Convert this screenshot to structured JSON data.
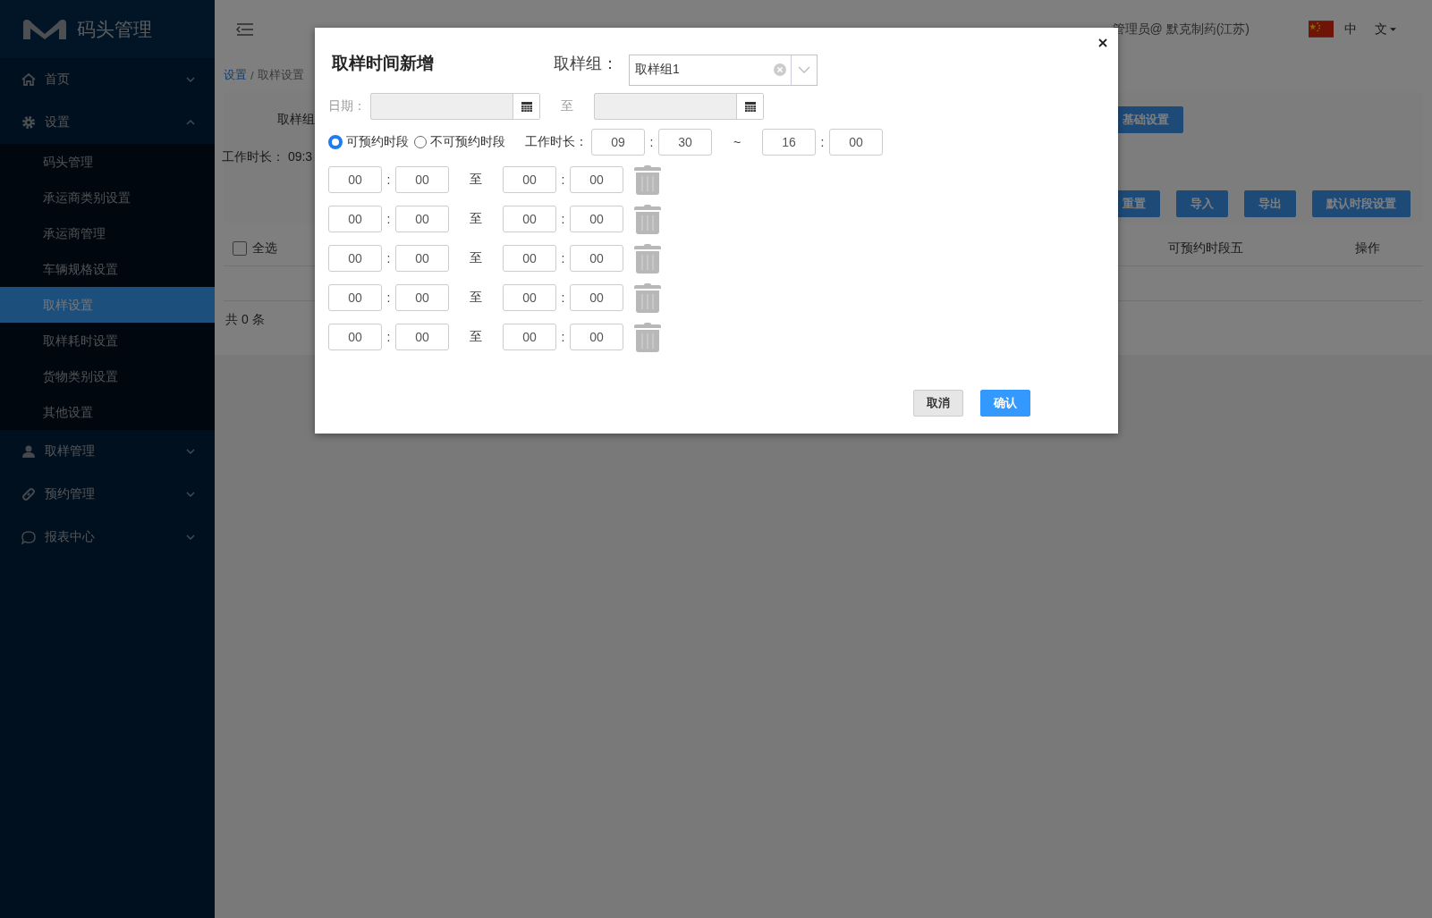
{
  "sidebar": {
    "logo_text": "码头管理",
    "items": [
      {
        "label": "首页",
        "expanded": false
      },
      {
        "label": "设置",
        "expanded": true,
        "children": [
          {
            "label": "码头管理",
            "selected": false
          },
          {
            "label": "承运商类别设置",
            "selected": false
          },
          {
            "label": "承运商管理",
            "selected": false
          },
          {
            "label": "车辆规格设置",
            "selected": false
          },
          {
            "label": "取样设置",
            "selected": true
          },
          {
            "label": "取样耗时设置",
            "selected": false
          },
          {
            "label": "货物类别设置",
            "selected": false
          },
          {
            "label": "其他设置",
            "selected": false
          }
        ]
      },
      {
        "label": "取样管理",
        "expanded": false
      },
      {
        "label": "预约管理",
        "expanded": false
      },
      {
        "label": "报表中心",
        "expanded": false
      }
    ]
  },
  "header": {
    "user": "管理员@ 默克制药(江苏)",
    "language": "中",
    "lang_menu": "文"
  },
  "breadcrumb": {
    "items": [
      "设置",
      "取样设置"
    ],
    "separator": "/"
  },
  "search_panel": {
    "group_label": "取样组",
    "work_hours": "工作时长： 09:3",
    "basic_button": "基础设置"
  },
  "toolbar_buttons": [
    "重置",
    "导入",
    "导出",
    "默认时段设置"
  ],
  "table": {
    "select_all": {
      "label": "全选",
      "checked": false
    },
    "columns": [
      "可预约时段五",
      "操作"
    ],
    "total": "共 0 条"
  },
  "dialog": {
    "title": "取样时间新增",
    "group_label": "取样组：",
    "group_value": "取样组1",
    "date_label": "日期：",
    "date_sep": "至",
    "radios": [
      {
        "label": "可预约时段",
        "selected": true
      },
      {
        "label": "不可预约时段",
        "selected": false
      }
    ],
    "work_hours": {
      "label": "工作时长：",
      "start": {
        "hour": "09",
        "sep": ":",
        "minute": "30"
      },
      "sep": "~",
      "end": {
        "hour": "16",
        "sep": ":",
        "minute": "00"
      }
    },
    "slots": [
      {
        "from": {
          "hour": "00",
          "sep": ":",
          "minute": "00"
        },
        "sep": "至",
        "to": {
          "hour": "00",
          "sep": ":",
          "minute": "00"
        }
      },
      {
        "from": {
          "hour": "00",
          "sep": ":",
          "minute": "00"
        },
        "sep": "至",
        "to": {
          "hour": "00",
          "sep": ":",
          "minute": "00"
        }
      },
      {
        "from": {
          "hour": "00",
          "sep": ":",
          "minute": "00"
        },
        "sep": "至",
        "to": {
          "hour": "00",
          "sep": ":",
          "minute": "00"
        }
      },
      {
        "from": {
          "hour": "00",
          "sep": ":",
          "minute": "00"
        },
        "sep": "至",
        "to": {
          "hour": "00",
          "sep": ":",
          "minute": "00"
        }
      },
      {
        "from": {
          "hour": "00",
          "sep": ":",
          "minute": "00"
        },
        "sep": "至",
        "to": {
          "hour": "00",
          "sep": ":",
          "minute": "00"
        }
      }
    ],
    "buttons": [
      {
        "label": "取消",
        "kind": "default"
      },
      {
        "label": "确认",
        "kind": "primary"
      }
    ]
  }
}
